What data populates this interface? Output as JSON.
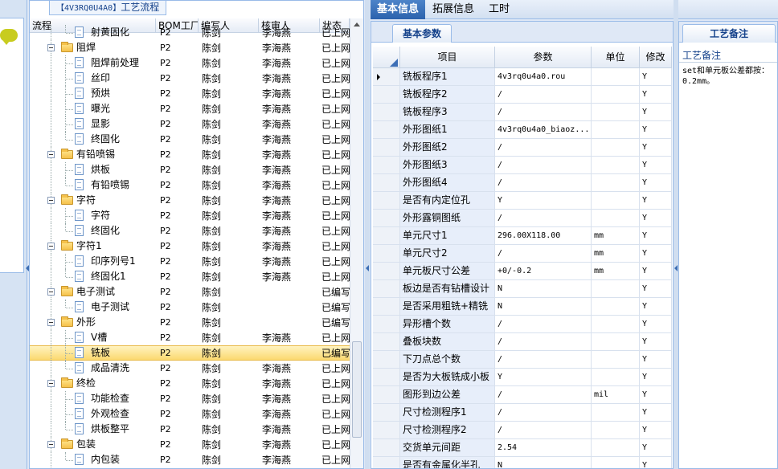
{
  "process_panel": {
    "title_code": "【4V3RQ0U4A0】",
    "title": "工艺流程",
    "columns": [
      "流程",
      "BOM工厂",
      "编写人",
      "核审人",
      "状态"
    ],
    "rows": [
      {
        "level": 1,
        "type": "leaf",
        "name": "射黄固化",
        "bom": "P2",
        "writer": "陈剑",
        "reviewer": "李海燕",
        "status": "已上网"
      },
      {
        "level": 0,
        "type": "group",
        "name": "阻焊",
        "bom": "P2",
        "writer": "陈剑",
        "reviewer": "李海燕",
        "status": "已上网"
      },
      {
        "level": 1,
        "type": "leaf",
        "name": "阻焊前处理",
        "bom": "P2",
        "writer": "陈剑",
        "reviewer": "李海燕",
        "status": "已上网"
      },
      {
        "level": 1,
        "type": "leaf",
        "name": "丝印",
        "bom": "P2",
        "writer": "陈剑",
        "reviewer": "李海燕",
        "status": "已上网"
      },
      {
        "level": 1,
        "type": "leaf",
        "name": "预烘",
        "bom": "P2",
        "writer": "陈剑",
        "reviewer": "李海燕",
        "status": "已上网"
      },
      {
        "level": 1,
        "type": "leaf",
        "name": "曝光",
        "bom": "P2",
        "writer": "陈剑",
        "reviewer": "李海燕",
        "status": "已上网"
      },
      {
        "level": 1,
        "type": "leaf",
        "name": "显影",
        "bom": "P2",
        "writer": "陈剑",
        "reviewer": "李海燕",
        "status": "已上网"
      },
      {
        "level": 1,
        "type": "leaf",
        "name": "终固化",
        "bom": "P2",
        "writer": "陈剑",
        "reviewer": "李海燕",
        "status": "已上网"
      },
      {
        "level": 0,
        "type": "group",
        "name": "有铅喷锡",
        "bom": "P2",
        "writer": "陈剑",
        "reviewer": "李海燕",
        "status": "已上网"
      },
      {
        "level": 1,
        "type": "leaf",
        "name": "烘板",
        "bom": "P2",
        "writer": "陈剑",
        "reviewer": "李海燕",
        "status": "已上网"
      },
      {
        "level": 1,
        "type": "leaf",
        "name": "有铅喷锡",
        "bom": "P2",
        "writer": "陈剑",
        "reviewer": "李海燕",
        "status": "已上网"
      },
      {
        "level": 0,
        "type": "group",
        "name": "字符",
        "bom": "P2",
        "writer": "陈剑",
        "reviewer": "李海燕",
        "status": "已上网"
      },
      {
        "level": 1,
        "type": "leaf",
        "name": "字符",
        "bom": "P2",
        "writer": "陈剑",
        "reviewer": "李海燕",
        "status": "已上网"
      },
      {
        "level": 1,
        "type": "leaf",
        "name": "终固化",
        "bom": "P2",
        "writer": "陈剑",
        "reviewer": "李海燕",
        "status": "已上网"
      },
      {
        "level": 0,
        "type": "group",
        "name": "字符1",
        "bom": "P2",
        "writer": "陈剑",
        "reviewer": "李海燕",
        "status": "已上网"
      },
      {
        "level": 1,
        "type": "leaf",
        "name": "印序列号1",
        "bom": "P2",
        "writer": "陈剑",
        "reviewer": "李海燕",
        "status": "已上网"
      },
      {
        "level": 1,
        "type": "leaf",
        "name": "终固化1",
        "bom": "P2",
        "writer": "陈剑",
        "reviewer": "李海燕",
        "status": "已上网"
      },
      {
        "level": 0,
        "type": "group",
        "name": "电子测试",
        "bom": "P2",
        "writer": "陈剑",
        "reviewer": "",
        "status": "已编写"
      },
      {
        "level": 1,
        "type": "leaf",
        "name": "电子测试",
        "bom": "P2",
        "writer": "陈剑",
        "reviewer": "",
        "status": "已编写"
      },
      {
        "level": 0,
        "type": "group",
        "name": "外形",
        "bom": "P2",
        "writer": "陈剑",
        "reviewer": "",
        "status": "已编写"
      },
      {
        "level": 1,
        "type": "leaf",
        "name": "V槽",
        "bom": "P2",
        "writer": "陈剑",
        "reviewer": "李海燕",
        "status": "已上网"
      },
      {
        "level": 1,
        "type": "leaf",
        "name": "铣板",
        "bom": "P2",
        "writer": "陈剑",
        "reviewer": "",
        "status": "已编写",
        "selected": true
      },
      {
        "level": 1,
        "type": "leaf",
        "name": "成品清洗",
        "bom": "P2",
        "writer": "陈剑",
        "reviewer": "李海燕",
        "status": "已上网"
      },
      {
        "level": 0,
        "type": "group",
        "name": "终检",
        "bom": "P2",
        "writer": "陈剑",
        "reviewer": "李海燕",
        "status": "已上网"
      },
      {
        "level": 1,
        "type": "leaf",
        "name": "功能检查",
        "bom": "P2",
        "writer": "陈剑",
        "reviewer": "李海燕",
        "status": "已上网"
      },
      {
        "level": 1,
        "type": "leaf",
        "name": "外观检查",
        "bom": "P2",
        "writer": "陈剑",
        "reviewer": "李海燕",
        "status": "已上网"
      },
      {
        "level": 1,
        "type": "leaf",
        "name": "烘板整平",
        "bom": "P2",
        "writer": "陈剑",
        "reviewer": "李海燕",
        "status": "已上网"
      },
      {
        "level": 0,
        "type": "group",
        "name": "包装",
        "bom": "P2",
        "writer": "陈剑",
        "reviewer": "李海燕",
        "status": "已上网"
      },
      {
        "level": 1,
        "type": "leaf",
        "name": "内包装",
        "bom": "P2",
        "writer": "陈剑",
        "reviewer": "李海燕",
        "status": "已上网"
      }
    ]
  },
  "top_tabs": [
    "基本信息",
    "拓展信息",
    "工时"
  ],
  "param_panel": {
    "tab": "基本参数",
    "columns": [
      "项目",
      "参数",
      "单位",
      "修改"
    ],
    "rows": [
      {
        "item": "铣板程序1",
        "value": "4v3rq0u4a0.rou",
        "unit": "",
        "mod": "Y",
        "current": true
      },
      {
        "item": "铣板程序2",
        "value": "/",
        "unit": "",
        "mod": "Y"
      },
      {
        "item": "铣板程序3",
        "value": "/",
        "unit": "",
        "mod": "Y"
      },
      {
        "item": "外形图纸1",
        "value": "4v3rq0u4a0_biaoz...",
        "unit": "",
        "mod": "Y"
      },
      {
        "item": "外形图纸2",
        "value": "/",
        "unit": "",
        "mod": "Y"
      },
      {
        "item": "外形图纸3",
        "value": "/",
        "unit": "",
        "mod": "Y"
      },
      {
        "item": "外形图纸4",
        "value": "/",
        "unit": "",
        "mod": "Y"
      },
      {
        "item": "是否有内定位孔",
        "value": "Y",
        "unit": "",
        "mod": "Y"
      },
      {
        "item": "外形露铜图纸",
        "value": "/",
        "unit": "",
        "mod": "Y"
      },
      {
        "item": "单元尺寸1",
        "value": "296.00X118.00",
        "unit": "mm",
        "mod": "Y"
      },
      {
        "item": "单元尺寸2",
        "value": "/",
        "unit": "mm",
        "mod": "Y"
      },
      {
        "item": "单元板尺寸公差",
        "value": "+0/-0.2",
        "unit": "mm",
        "mod": "Y"
      },
      {
        "item": "板边是否有钻槽设计",
        "value": "N",
        "unit": "",
        "mod": "Y"
      },
      {
        "item": "是否采用粗铣+精铣",
        "value": "N",
        "unit": "",
        "mod": "Y"
      },
      {
        "item": "异形槽个数",
        "value": "/",
        "unit": "",
        "mod": "Y"
      },
      {
        "item": "叠板块数",
        "value": "/",
        "unit": "",
        "mod": "Y"
      },
      {
        "item": "下刀点总个数",
        "value": "/",
        "unit": "",
        "mod": "Y"
      },
      {
        "item": "是否为大板铣成小板",
        "value": "Y",
        "unit": "",
        "mod": "Y"
      },
      {
        "item": "图形到边公差",
        "value": "/",
        "unit": "mil",
        "mod": "Y"
      },
      {
        "item": "尺寸检测程序1",
        "value": "/",
        "unit": "",
        "mod": "Y"
      },
      {
        "item": "尺寸检测程序2",
        "value": "/",
        "unit": "",
        "mod": "Y"
      },
      {
        "item": "交货单元间距",
        "value": "2.54",
        "unit": "",
        "mod": "Y"
      },
      {
        "item": "是否有金属化半孔",
        "value": "N",
        "unit": "",
        "mod": "Y"
      }
    ]
  },
  "note_panel": {
    "tab": "工艺备注",
    "label": "工艺备注",
    "text": "set和单元板公差都按：\n0.2mm。"
  }
}
